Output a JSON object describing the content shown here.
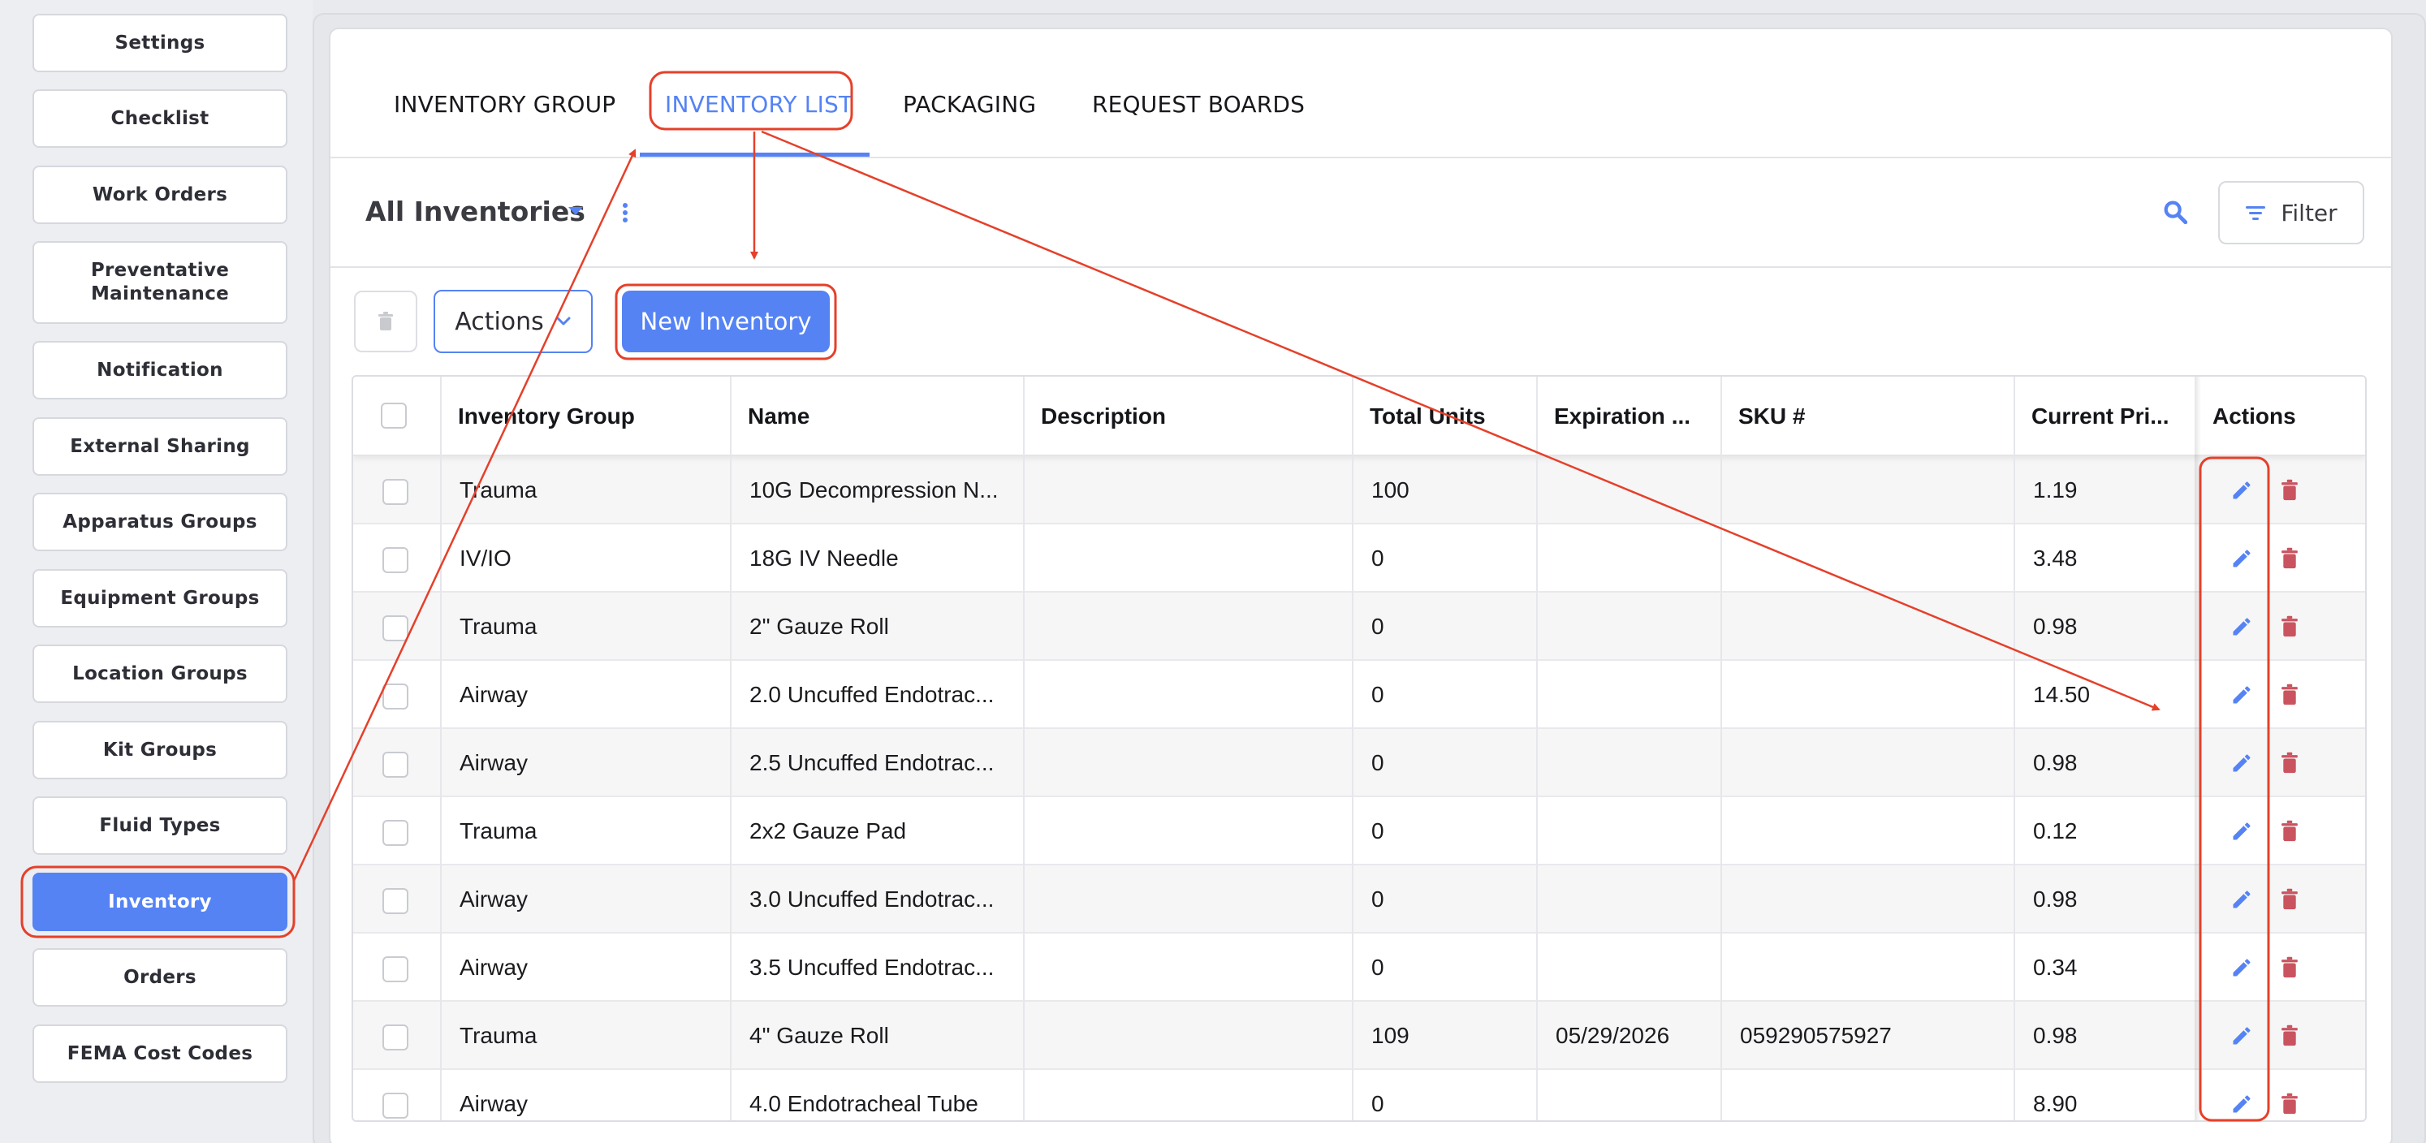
{
  "sidebar": {
    "items": [
      {
        "label": "Settings"
      },
      {
        "label": "Checklist"
      },
      {
        "label": "Work Orders"
      },
      {
        "label": "Preventative Maintenance"
      },
      {
        "label": "Notification"
      },
      {
        "label": "External Sharing"
      },
      {
        "label": "Apparatus Groups"
      },
      {
        "label": "Equipment Groups"
      },
      {
        "label": "Location Groups"
      },
      {
        "label": "Kit Groups"
      },
      {
        "label": "Fluid Types"
      },
      {
        "label": "Inventory",
        "active": true
      },
      {
        "label": "Orders"
      },
      {
        "label": "FEMA Cost Codes"
      }
    ]
  },
  "tabs": [
    {
      "label": "INVENTORY GROUP"
    },
    {
      "label": "INVENTORY LIST",
      "active": true
    },
    {
      "label": "PACKAGING"
    },
    {
      "label": "REQUEST BOARDS"
    }
  ],
  "toolbar": {
    "view_title": "All Inventories",
    "filter_label": "Filter",
    "actions_label": "Actions",
    "new_label": "New Inventory"
  },
  "table": {
    "columns": [
      "Inventory Group",
      "Name",
      "Description",
      "Total Units",
      "Expiration ...",
      "SKU #",
      "Current Pri...",
      "Actions"
    ],
    "rows": [
      {
        "group": "Trauma",
        "name": "10G Decompression N...",
        "description": "",
        "units": "100",
        "expiration": "",
        "sku": "",
        "price": "1.19"
      },
      {
        "group": "IV/IO",
        "name": "18G IV Needle",
        "description": "",
        "units": "0",
        "expiration": "",
        "sku": "",
        "price": "3.48"
      },
      {
        "group": "Trauma",
        "name": "2\" Gauze Roll",
        "description": "",
        "units": "0",
        "expiration": "",
        "sku": "",
        "price": "0.98"
      },
      {
        "group": "Airway",
        "name": "2.0 Uncuffed Endotrac...",
        "description": "",
        "units": "0",
        "expiration": "",
        "sku": "",
        "price": "14.50"
      },
      {
        "group": "Airway",
        "name": "2.5 Uncuffed Endotrac...",
        "description": "",
        "units": "0",
        "expiration": "",
        "sku": "",
        "price": "0.98"
      },
      {
        "group": "Trauma",
        "name": "2x2 Gauze Pad",
        "description": "",
        "units": "0",
        "expiration": "",
        "sku": "",
        "price": "0.12"
      },
      {
        "group": "Airway",
        "name": "3.0 Uncuffed Endotrac...",
        "description": "",
        "units": "0",
        "expiration": "",
        "sku": "",
        "price": "0.98"
      },
      {
        "group": "Airway",
        "name": "3.5 Uncuffed Endotrac...",
        "description": "",
        "units": "0",
        "expiration": "",
        "sku": "",
        "price": "0.34"
      },
      {
        "group": "Trauma",
        "name": "4\" Gauze Roll",
        "description": "",
        "units": "109",
        "expiration": "05/29/2026",
        "sku": "059290575927",
        "price": "0.98"
      },
      {
        "group": "Airway",
        "name": "4.0 Endotracheal Tube",
        "description": "",
        "units": "0",
        "expiration": "",
        "sku": "",
        "price": "8.90"
      }
    ]
  },
  "colors": {
    "accent": "#5583f4",
    "delete": "#c9545f",
    "annotation": "#e5402a"
  },
  "icons": {
    "edit": "pencil-icon",
    "delete": "trash-icon",
    "search": "search-icon",
    "filter": "filter-icon",
    "menu": "kebab-menu-icon"
  }
}
